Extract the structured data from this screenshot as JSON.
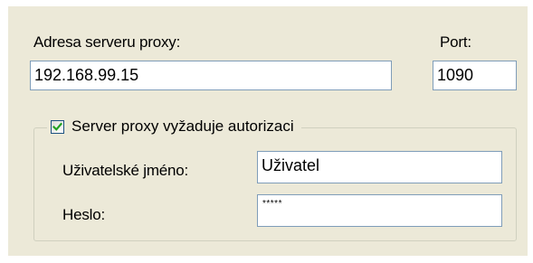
{
  "proxy": {
    "address_label": "Adresa serveru proxy:",
    "address_value": "192.168.99.15",
    "port_label": "Port:",
    "port_value": "1090"
  },
  "auth": {
    "checkbox_label": "Server proxy vyžaduje autorizaci",
    "checked": true,
    "username_label": "Uživatelské jméno:",
    "username_value": "Uživatel",
    "password_label": "Heslo:",
    "password_value": "*****"
  },
  "colors": {
    "panel_background": "#ece9d8",
    "textbox_border": "#7f9db9",
    "checkmark": "#21a121"
  }
}
